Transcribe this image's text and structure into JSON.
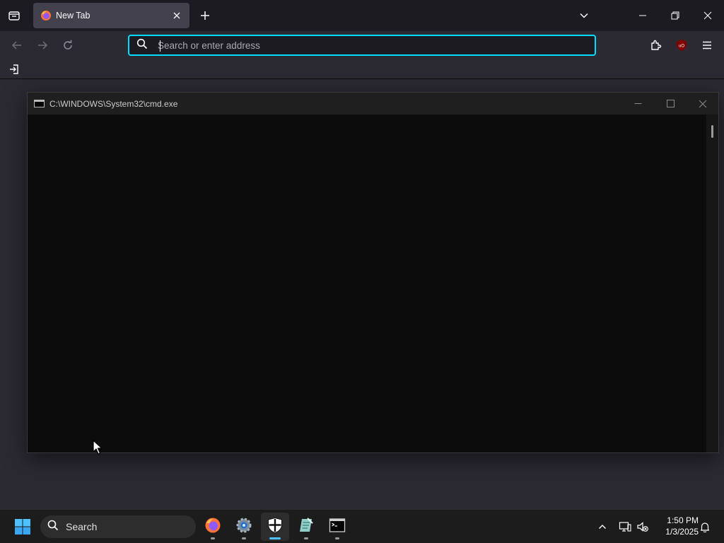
{
  "browser": {
    "tab": {
      "title": "New Tab"
    },
    "urlbar": {
      "placeholder": "Search or enter address",
      "value": ""
    }
  },
  "cmd_window": {
    "title": "C:\\WINDOWS\\System32\\cmd.exe"
  },
  "taskbar": {
    "search_label": "Search",
    "clock": {
      "time": "1:50 PM",
      "date": "1/3/2025"
    },
    "apps": [
      "firefox-icon",
      "settings-icon",
      "windows-security-icon",
      "notepad-icon",
      "terminal-icon"
    ]
  },
  "colors": {
    "accent": "#00ddff",
    "taskbar_indicator": "#4cc2ff",
    "chrome_bg": "#1c1b22",
    "toolbar_bg": "#2b2a33"
  }
}
